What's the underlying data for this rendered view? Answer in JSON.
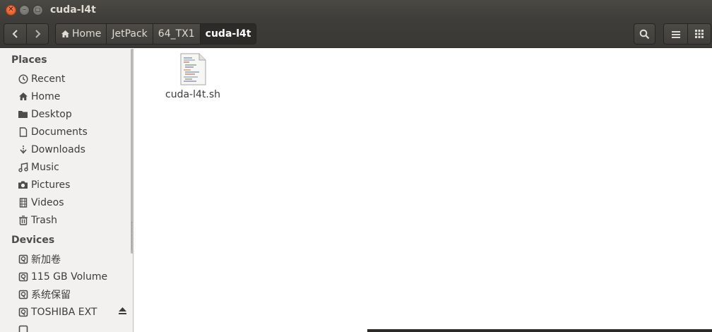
{
  "window": {
    "title": "cuda-l4t"
  },
  "breadcrumbs": [
    "Home",
    "JetPack",
    "64_TX1",
    "cuda-l4t"
  ],
  "sidebar": {
    "places_heading": "Places",
    "places": [
      {
        "label": "Recent",
        "icon": "clock-icon"
      },
      {
        "label": "Home",
        "icon": "home-icon"
      },
      {
        "label": "Desktop",
        "icon": "folder-icon"
      },
      {
        "label": "Documents",
        "icon": "document-icon"
      },
      {
        "label": "Downloads",
        "icon": "download-icon"
      },
      {
        "label": "Music",
        "icon": "music-icon"
      },
      {
        "label": "Pictures",
        "icon": "camera-icon"
      },
      {
        "label": "Videos",
        "icon": "film-icon"
      },
      {
        "label": "Trash",
        "icon": "trash-icon"
      }
    ],
    "devices_heading": "Devices",
    "devices": [
      {
        "label": "新加卷",
        "icon": "drive-icon"
      },
      {
        "label": "115 GB Volume",
        "icon": "drive-icon"
      },
      {
        "label": "系统保留",
        "icon": "drive-icon"
      },
      {
        "label": "TOSHIBA EXT",
        "icon": "drive-icon",
        "ejectable": true
      }
    ]
  },
  "files": [
    {
      "name": "cuda-l4t.sh",
      "icon": "shell-script-icon"
    }
  ],
  "colors": {
    "titlebar": "#3e3d39",
    "close_button": "#df4a16",
    "sidebar_bg": "#f2f1f0",
    "content_bg": "#ffffff"
  }
}
